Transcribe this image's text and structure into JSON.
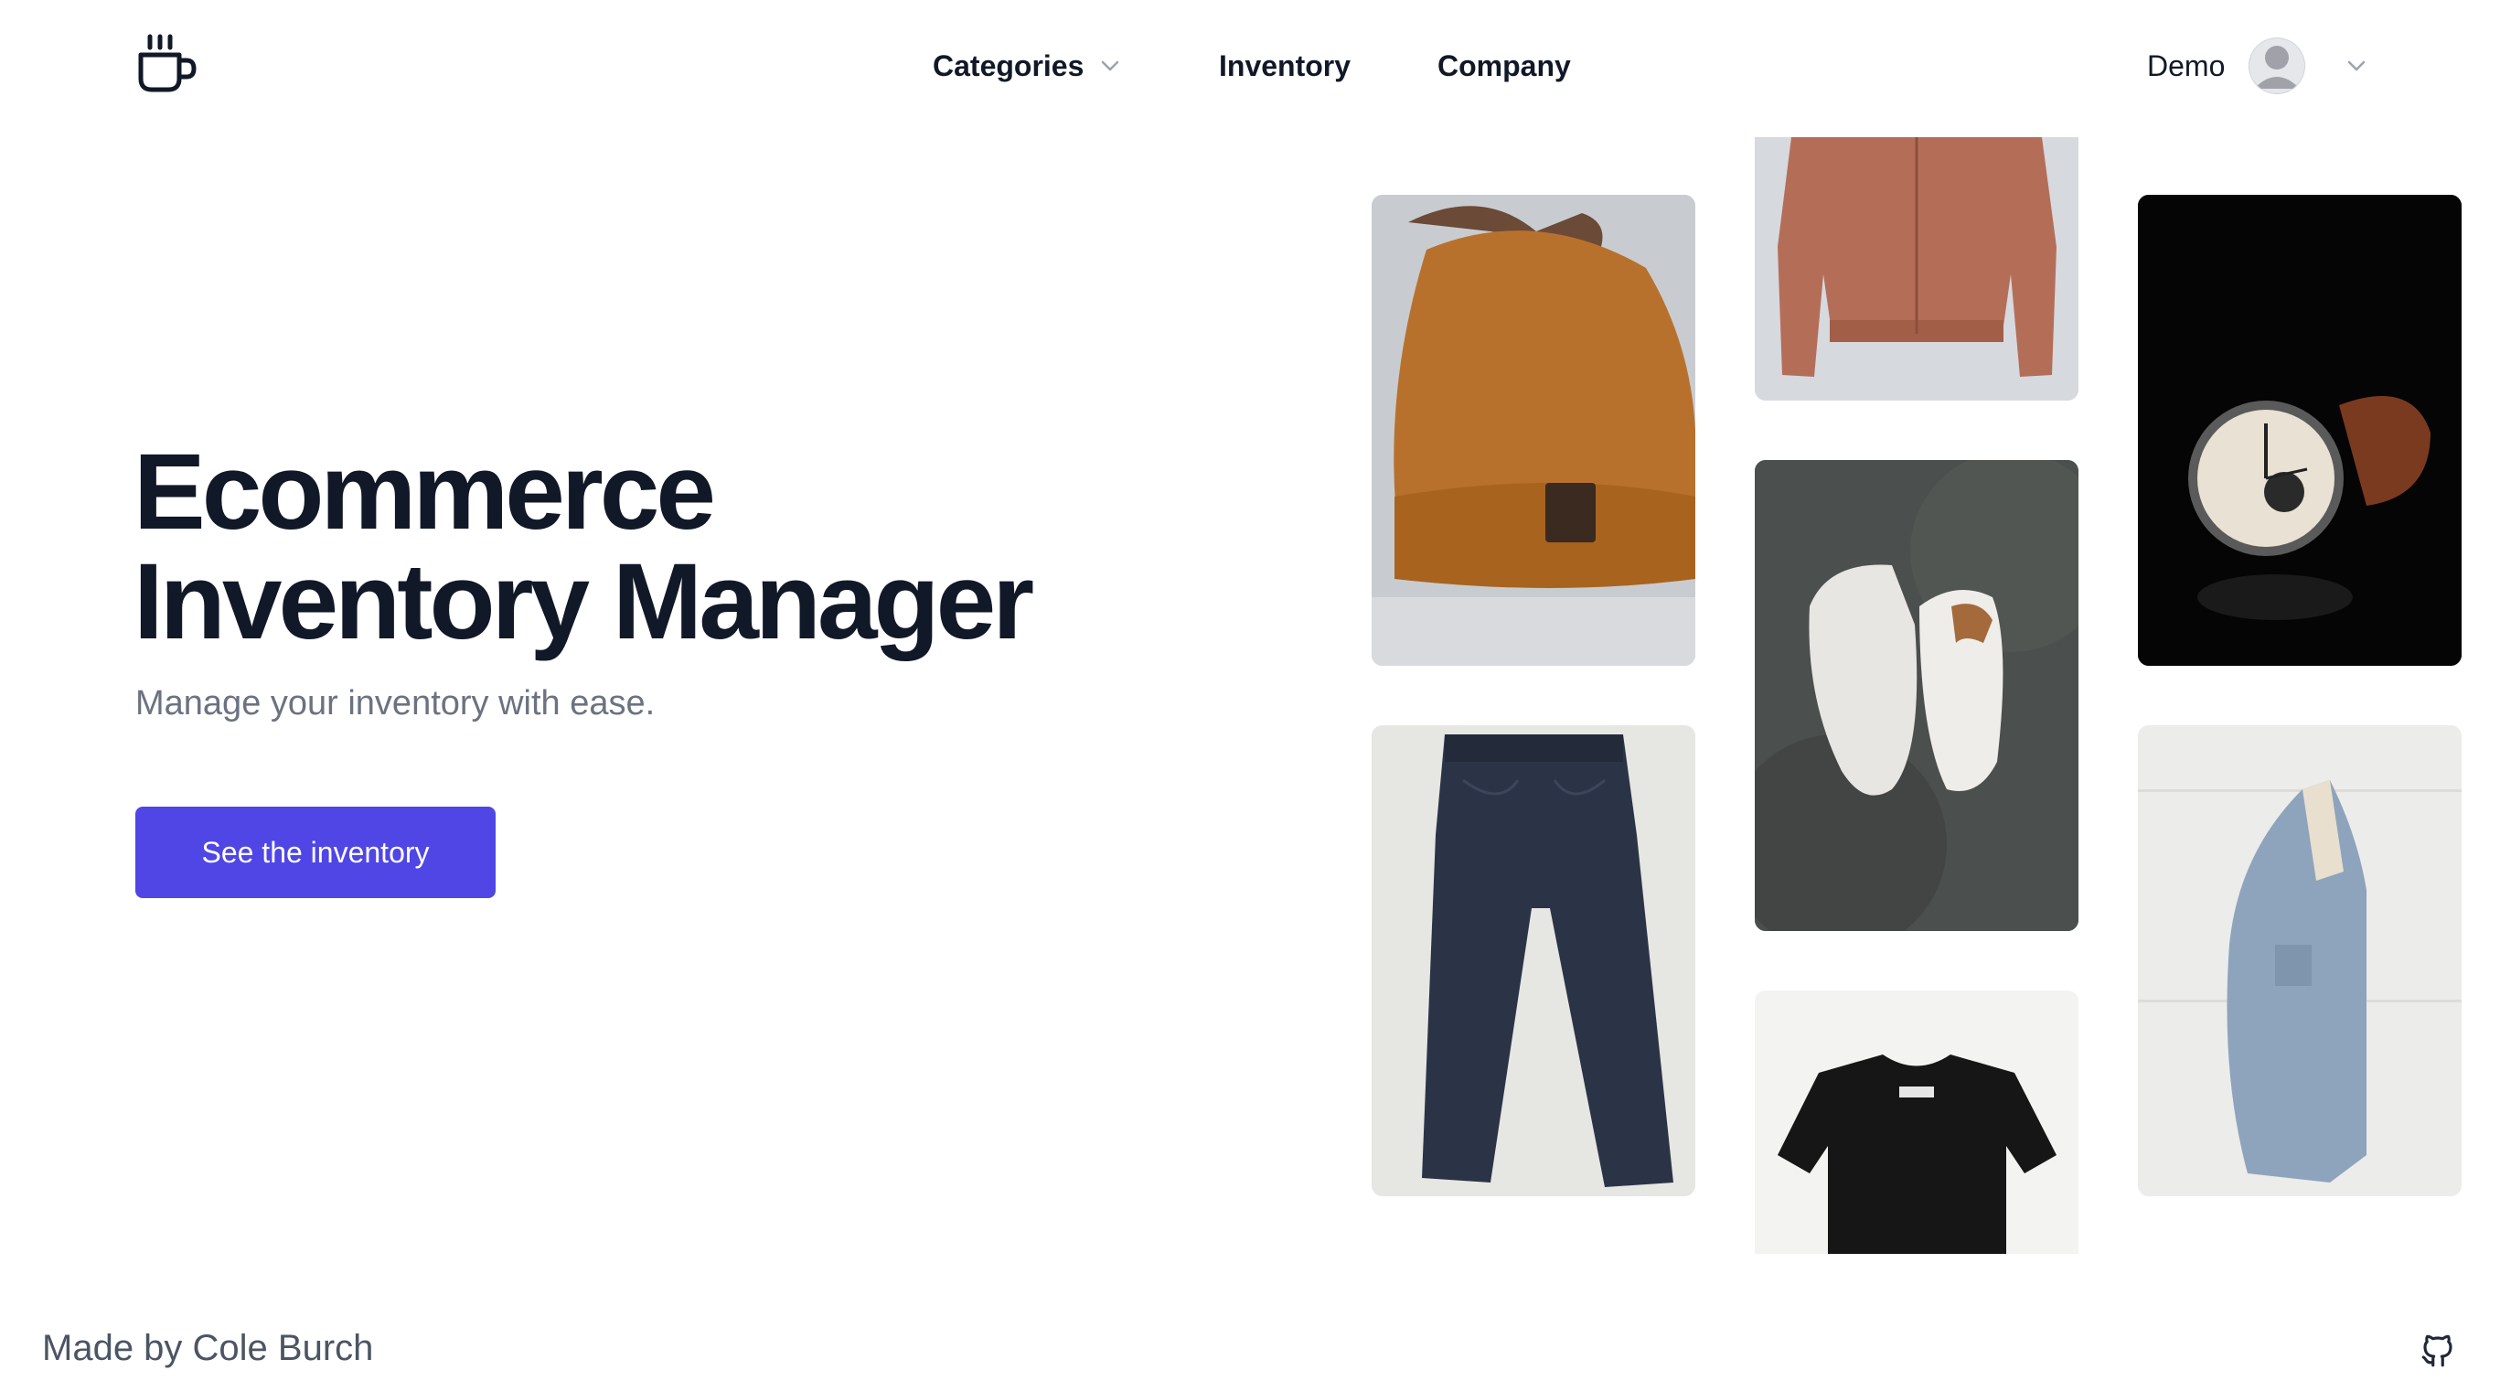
{
  "header": {
    "logo_icon": "coffee-mug-icon",
    "nav": {
      "categories": "Categories",
      "inventory": "Inventory",
      "company": "Company"
    },
    "user": {
      "name": "Demo",
      "avatar_icon": "user-avatar-icon",
      "menu_icon": "chevron-down-icon"
    }
  },
  "hero": {
    "title_line1": "Ecommerce",
    "title_line2": "Inventory Manager",
    "subtitle": "Manage your inventory with ease.",
    "cta_label": "See the inventory",
    "cta_color": "#4f46e5"
  },
  "gallery": {
    "images": [
      "beanie",
      "jeans",
      "bomber-jacket",
      "sneakers",
      "t-shirt",
      "watch",
      "denim-jacket"
    ]
  },
  "footer": {
    "credit": "Made by Cole Burch",
    "github_icon": "github-icon"
  }
}
